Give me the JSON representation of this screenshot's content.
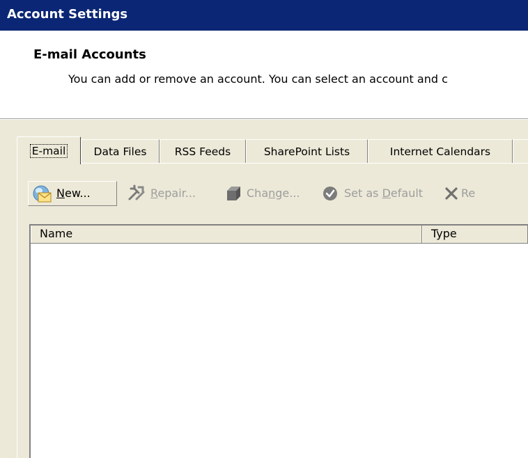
{
  "window": {
    "title": "Account Settings"
  },
  "header": {
    "title": "E-mail Accounts",
    "description": "You can add or remove an account. You can select an account and c"
  },
  "tabs": [
    {
      "label": "E-mail",
      "active": true
    },
    {
      "label": "Data Files",
      "active": false
    },
    {
      "label": "RSS Feeds",
      "active": false
    },
    {
      "label": "SharePoint Lists",
      "active": false
    },
    {
      "label": "Internet Calendars",
      "active": false
    }
  ],
  "toolbar": {
    "new": {
      "pre": "",
      "key": "N",
      "post": "ew...",
      "icon": "new-mail-account-icon",
      "enabled": true
    },
    "repair": {
      "pre": "",
      "key": "R",
      "post": "epair...",
      "icon": "repair-tools-icon",
      "enabled": false
    },
    "change": {
      "pre": "Cha",
      "key": "n",
      "post": "ge...",
      "icon": "change-icon",
      "enabled": false
    },
    "set_default": {
      "pre": "Set as ",
      "key": "D",
      "post": "efault",
      "icon": "checkmark-circle-icon",
      "enabled": false
    },
    "remove": {
      "pre": "",
      "key": "",
      "post": "Re",
      "icon": "remove-x-icon",
      "enabled": false
    }
  },
  "list": {
    "columns": [
      "Name",
      "Type"
    ],
    "rows": []
  },
  "colors": {
    "titlebar": "#0b2675",
    "dialog_face": "#ece9d8",
    "disabled_text": "#9d9d9d"
  }
}
